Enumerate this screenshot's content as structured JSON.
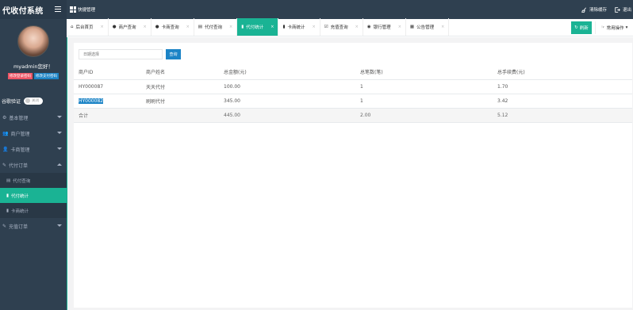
{
  "app": {
    "title": "代收付系统"
  },
  "topbar": {
    "quicknav_label": "快捷管理",
    "clear_cache_label": "清除缓存",
    "logout_label": "退出"
  },
  "profile": {
    "welcome": "myadmin您好！",
    "edit_login_pwd": "修改登录密码",
    "edit_pay_pwd": "修改支付密码"
  },
  "google_auth": {
    "label": "谷歌验证",
    "state": "关闭"
  },
  "menu": {
    "basic": "基本管理",
    "merchant": "商户管理",
    "card": "卡商管理",
    "payout_orders": "代付订单",
    "payout_query": "代付查询",
    "payout_stats": "代付统计",
    "card_stats": "卡商统计",
    "recharge_orders": "充值订单"
  },
  "tabs": [
    {
      "label": "后台首页"
    },
    {
      "label": "商户查询"
    },
    {
      "label": "卡商查询"
    },
    {
      "label": "代付查询"
    },
    {
      "label": "代付统计"
    },
    {
      "label": "卡商统计"
    },
    {
      "label": "充值查询"
    },
    {
      "label": "银行管理"
    },
    {
      "label": "公告管理"
    }
  ],
  "tab_actions": {
    "refresh": "刷新",
    "common_ops": "常用操作"
  },
  "search": {
    "placeholder": "日期选择",
    "button": "查询"
  },
  "table": {
    "headers": [
      "商户ID",
      "商户姓名",
      "总金额(元)",
      "总笔数(笔)",
      "总手续费(元)"
    ],
    "rows": [
      [
        "HY000087",
        "天天代付",
        "100.00",
        "1",
        "1.70"
      ],
      [
        "HY000082",
        "刷刷代付",
        "345.00",
        "1",
        "3.42"
      ]
    ],
    "total": [
      "合计",
      "",
      "445.00",
      "2.00",
      "5.12"
    ]
  },
  "colors": {
    "accent": "#1ab394",
    "sidebar": "#2f4050",
    "primary": "#1c84c6"
  }
}
